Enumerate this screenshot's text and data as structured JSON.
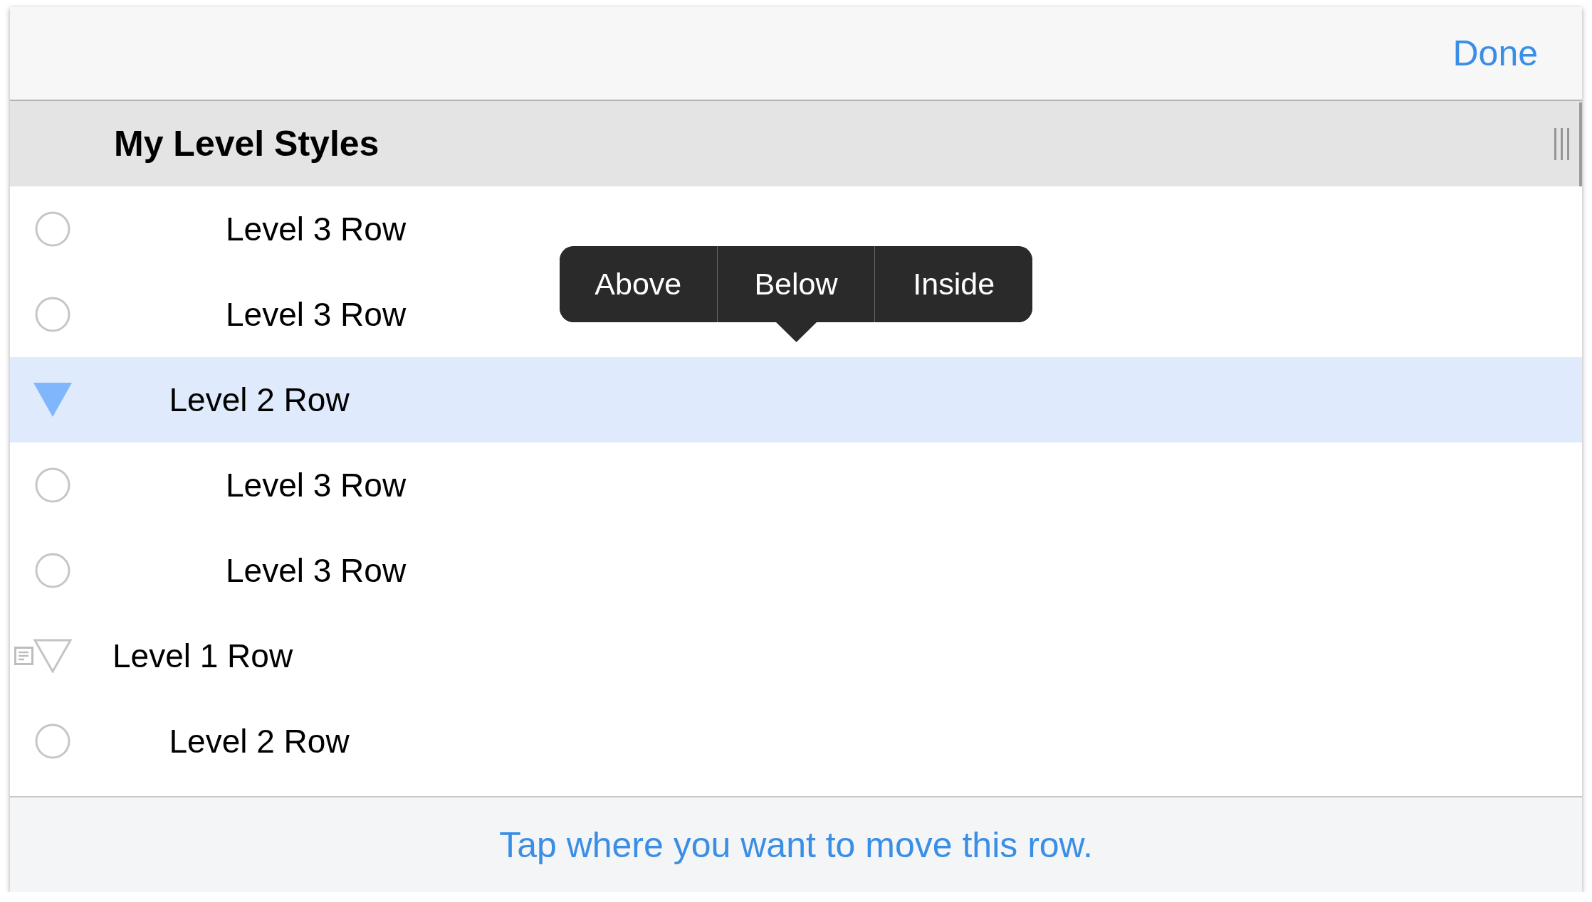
{
  "nav_bar": {
    "done_button": "Done"
  },
  "section_header": {
    "title": "My Level Styles"
  },
  "outline": {
    "children": [
      {
        "children": [
          {
            "children": [
              {
                "label": "Level 3 Row",
                "kind": "leaf",
                "selected": false,
                "note": false
              },
              {
                "label": "Level 3 Row",
                "kind": "leaf",
                "selected": false,
                "note": false
              }
            ]
          },
          {
            "label": "Level 2 Row",
            "kind": "parent",
            "expanded": true,
            "selected": true,
            "note": false,
            "children": [
              {
                "label": "Level 3 Row",
                "kind": "leaf",
                "selected": false,
                "note": false
              },
              {
                "label": "Level 3 Row",
                "kind": "leaf",
                "selected": false,
                "note": false
              }
            ]
          }
        ]
      },
      {
        "label": "Level 1 Row",
        "kind": "parent",
        "expanded": true,
        "selected": false,
        "note": true,
        "children": [
          {
            "label": "Level 2 Row",
            "kind": "leaf",
            "selected": false,
            "note": false
          }
        ]
      }
    ]
  },
  "move_menu": {
    "options": [
      "Above",
      "Below",
      "Inside"
    ]
  },
  "instruction": "Tap where you want to move this row."
}
